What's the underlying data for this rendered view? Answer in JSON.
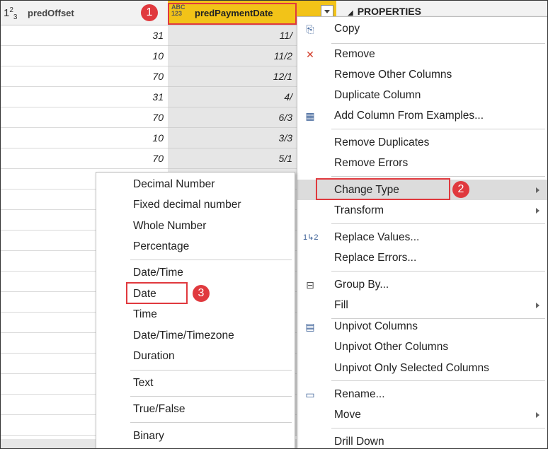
{
  "header": {
    "col1_type_icon": "whole-number-icon",
    "col1_label": "predOffset",
    "col2_type_icon_top": "ABC",
    "col2_type_icon_bottom": "123",
    "col2_label": "predPaymentDate",
    "properties_title": "PROPERTIES"
  },
  "grid": {
    "pred_offset": [
      "31",
      "10",
      "70",
      "31",
      "70",
      "10",
      "70"
    ],
    "pred_payment_date": [
      "11/",
      "11/2",
      "12/1",
      "4/",
      "6/3",
      "3/3",
      "5/1"
    ]
  },
  "callouts": [
    "1",
    "2",
    "3"
  ],
  "context_menu": {
    "items": [
      {
        "label": "Copy",
        "icon": "copy-icon"
      },
      {
        "label": "Remove",
        "icon": "remove-icon"
      },
      {
        "label": "Remove Other Columns"
      },
      {
        "label": "Duplicate Column"
      },
      {
        "label": "Add Column From Examples...",
        "icon": "add-column-examples-icon"
      },
      {
        "label": "Remove Duplicates"
      },
      {
        "label": "Remove Errors"
      },
      {
        "label": "Change Type",
        "submenu": true,
        "highlighted": true
      },
      {
        "label": "Transform",
        "submenu": true
      },
      {
        "label": "Replace Values...",
        "icon": "replace-values-icon"
      },
      {
        "label": "Replace Errors..."
      },
      {
        "label": "Group By...",
        "icon": "group-by-icon"
      },
      {
        "label": "Fill",
        "submenu": true
      },
      {
        "label": "Unpivot Columns",
        "icon": "unpivot-icon"
      },
      {
        "label": "Unpivot Other Columns"
      },
      {
        "label": "Unpivot Only Selected Columns"
      },
      {
        "label": "Rename...",
        "icon": "rename-icon"
      },
      {
        "label": "Move",
        "submenu": true
      },
      {
        "label": "Drill Down"
      }
    ]
  },
  "change_type_submenu": {
    "items": [
      "Decimal Number",
      "Fixed decimal number",
      "Whole Number",
      "Percentage",
      "Date/Time",
      "Date",
      "Time",
      "Date/Time/Timezone",
      "Duration",
      "Text",
      "True/False",
      "Binary"
    ]
  },
  "colors": {
    "selected_header": "#f2c318",
    "callout_red": "#e0393e",
    "highlight": "#dcdcdc"
  }
}
